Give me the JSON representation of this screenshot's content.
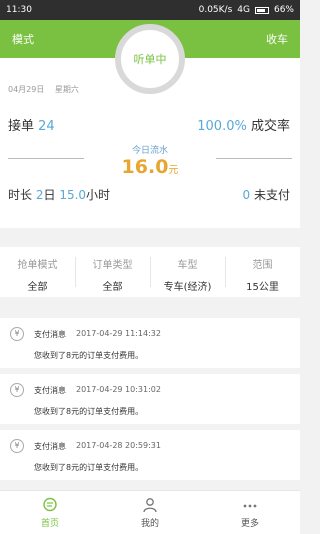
{
  "status_bar": {
    "time": "11:30",
    "net_speed": "0.05K/s",
    "network": "4G",
    "battery": "66%"
  },
  "header": {
    "mode_label": "模式",
    "listen_label": "听单中",
    "close_label": "收车"
  },
  "summary": {
    "date": "04月29日",
    "weekday": "星期六",
    "orders_label": "接单",
    "orders_count": "24",
    "rate_value": "100.0%",
    "rate_label": "成交率",
    "flow_label": "今日流水",
    "flow_value": "16.0",
    "flow_unit": "元",
    "duration_label": "时长",
    "duration_days": "2",
    "duration_days_unit": "日",
    "duration_hours": "15.0",
    "duration_hours_unit": "小时",
    "unpaid_count": "0",
    "unpaid_label": "未支付"
  },
  "filters": [
    {
      "label": "抢单模式",
      "value": "全部"
    },
    {
      "label": "订单类型",
      "value": "全部"
    },
    {
      "label": "车型",
      "value": "专车(经济)"
    },
    {
      "label": "范围",
      "value": "15公里"
    }
  ],
  "messages": [
    {
      "title": "支付消息",
      "time": "2017-04-29 11:14:32",
      "body": "您收到了8元的订单支付费用。"
    },
    {
      "title": "支付消息",
      "time": "2017-04-29 10:31:02",
      "body": "您收到了8元的订单支付费用。"
    },
    {
      "title": "支付消息",
      "time": "2017-04-28 20:59:31",
      "body": "您收到了8元的订单支付费用。"
    }
  ],
  "tabs": [
    {
      "label": "首页",
      "icon": "chat-icon",
      "active": true
    },
    {
      "label": "我的",
      "icon": "user-icon",
      "active": false
    },
    {
      "label": "更多",
      "icon": "more-icon",
      "active": false
    }
  ],
  "colors": {
    "brand": "#7ac142",
    "accent_blue": "#58a9d6",
    "flow_orange": "#e8a530"
  }
}
